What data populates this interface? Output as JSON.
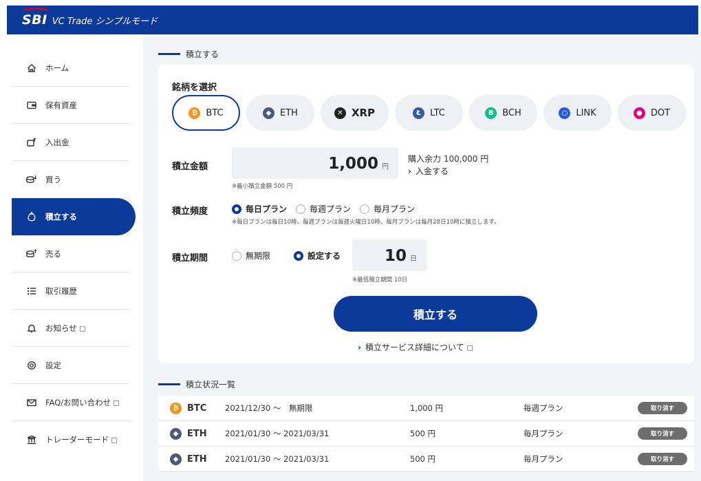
{
  "header": {
    "logo": "SBI",
    "title": "VC Trade シンプルモード"
  },
  "sidebar": {
    "items": [
      {
        "label": "ホーム",
        "icon": "home-icon"
      },
      {
        "label": "保有資産",
        "icon": "assets-icon"
      },
      {
        "label": "入出金",
        "icon": "deposit-withdraw-icon"
      },
      {
        "label": "買う",
        "icon": "buy-icon"
      },
      {
        "label": "積立する",
        "icon": "accumulate-icon",
        "active": true
      },
      {
        "label": "売る",
        "icon": "sell-icon"
      },
      {
        "label": "取引履歴",
        "icon": "history-icon"
      },
      {
        "label": "お知らせ",
        "icon": "bell-icon",
        "external": true
      },
      {
        "label": "設定",
        "icon": "gear-icon"
      },
      {
        "label": "FAQ/お問い合わせ",
        "icon": "mail-icon",
        "external": true
      },
      {
        "label": "トレーダーモード",
        "icon": "trader-icon",
        "external": true
      }
    ]
  },
  "form": {
    "section_title": "積立する",
    "select_label": "銘柄を選択",
    "coins": [
      {
        "symbol": "BTC",
        "color": "#f7931a",
        "glyph": "₿"
      },
      {
        "symbol": "ETH",
        "color": "#4a5a78",
        "glyph": "◆"
      },
      {
        "symbol": "XRP",
        "color": "#222222",
        "glyph": "✕"
      },
      {
        "symbol": "LTC",
        "color": "#345d9d",
        "glyph": "Ł"
      },
      {
        "symbol": "BCH",
        "color": "#0ac18e",
        "glyph": "B"
      },
      {
        "symbol": "LINK",
        "color": "#2a5ada",
        "glyph": "○"
      },
      {
        "symbol": "DOT",
        "color": "#e6007a",
        "glyph": "●"
      }
    ],
    "selected_coin": "BTC",
    "amount_label": "積立金額",
    "amount_value": "1,000",
    "amount_unit": "円",
    "min_amount_note": "※最小積立金額 500 円",
    "balance_text": "購入余力 100,000 円",
    "deposit_link": "入金する",
    "frequency_label": "積立頻度",
    "frequency_options": [
      "毎日プラン",
      "毎週プラン",
      "毎月プラン"
    ],
    "frequency_selected": "毎日プラン",
    "frequency_note": "※毎日プランは毎日10時、毎週プランは毎週火曜日10時、毎月プランは毎月28日10時に積立します。",
    "period_label": "積立期間",
    "period_options": [
      "無期限",
      "設定する"
    ],
    "period_selected": "設定する",
    "period_value": "10",
    "period_unit": "日",
    "min_period_note": "※最低積立期間 10日",
    "submit_label": "積立する",
    "detail_link": "積立サービス詳細について"
  },
  "status": {
    "section_title": "積立状況一覧",
    "cancel_label": "取り消す",
    "rows": [
      {
        "coin": "BTC",
        "color": "#f7931a",
        "glyph": "₿",
        "period": "2021/12/30 ～　無期限",
        "amount": "1,000 円",
        "plan": "毎週プラン"
      },
      {
        "coin": "ETH",
        "color": "#4a5a78",
        "glyph": "◆",
        "period": "2021/01/30 ～ 2021/03/31",
        "amount": "500 円",
        "plan": "毎月プラン"
      },
      {
        "coin": "ETH",
        "color": "#4a5a78",
        "glyph": "◆",
        "period": "2021/01/30 ～ 2021/03/31",
        "amount": "500 円",
        "plan": "毎月プラン"
      }
    ]
  },
  "colors": {
    "brand": "#0b3a9b",
    "panel": "#f3f4f7",
    "cancel": "#6d6d6d"
  }
}
